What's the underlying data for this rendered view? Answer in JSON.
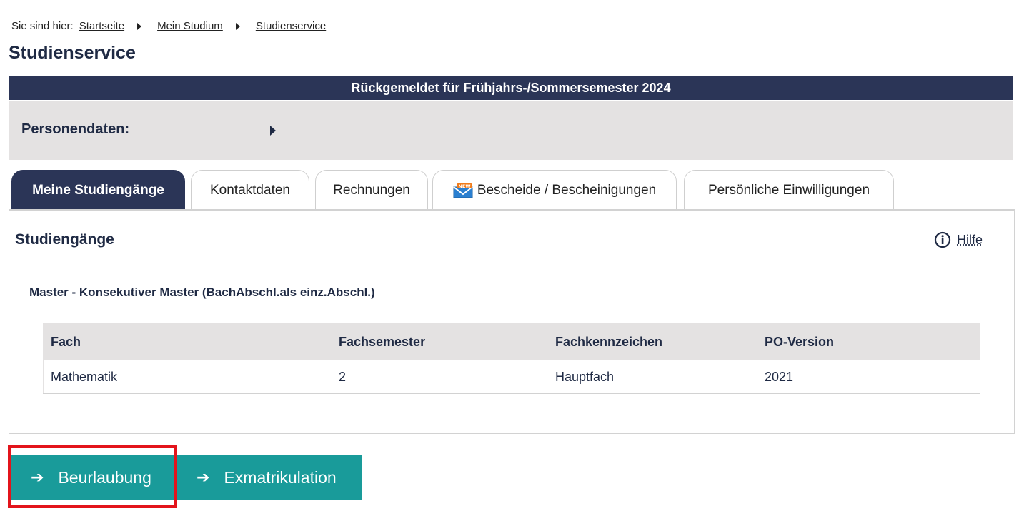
{
  "breadcrumb": {
    "prefix": "Sie sind hier:",
    "items": [
      {
        "label": "Startseite"
      },
      {
        "label": "Mein Studium"
      },
      {
        "label": "Studienservice"
      }
    ]
  },
  "page_title": "Studienservice",
  "banner": "Rückgemeldet für Frühjahrs-/Sommersemester 2024",
  "person": {
    "label": "Personendaten:"
  },
  "tabs": [
    {
      "label": "Meine Studiengänge",
      "active": true
    },
    {
      "label": "Kontaktdaten"
    },
    {
      "label": "Rechnungen"
    },
    {
      "label": "Bescheide / Bescheinigungen",
      "icon": "new-mail-icon",
      "badge": "NEW"
    },
    {
      "label": "Persönliche Einwilligungen"
    }
  ],
  "section": {
    "title": "Studiengänge",
    "help_label": "Hilfe",
    "degree": "Master - Konsekutiver Master (BachAbschl.als einz.Abschl.)"
  },
  "table": {
    "headers": [
      "Fach",
      "Fachsemester",
      "Fachkennzeichen",
      "PO-Version"
    ],
    "rows": [
      [
        "Mathematik",
        "2",
        "Hauptfach",
        "2021"
      ]
    ]
  },
  "actions": [
    {
      "label": "Beurlaubung",
      "icon": "arrow-right-icon",
      "highlighted": true
    },
    {
      "label": "Exmatrikulation",
      "icon": "arrow-right-icon"
    }
  ],
  "colors": {
    "navy": "#2b3557",
    "teal": "#199b9a",
    "highlight_red": "#e3141b",
    "panel_gray": "#e4e2e2"
  }
}
